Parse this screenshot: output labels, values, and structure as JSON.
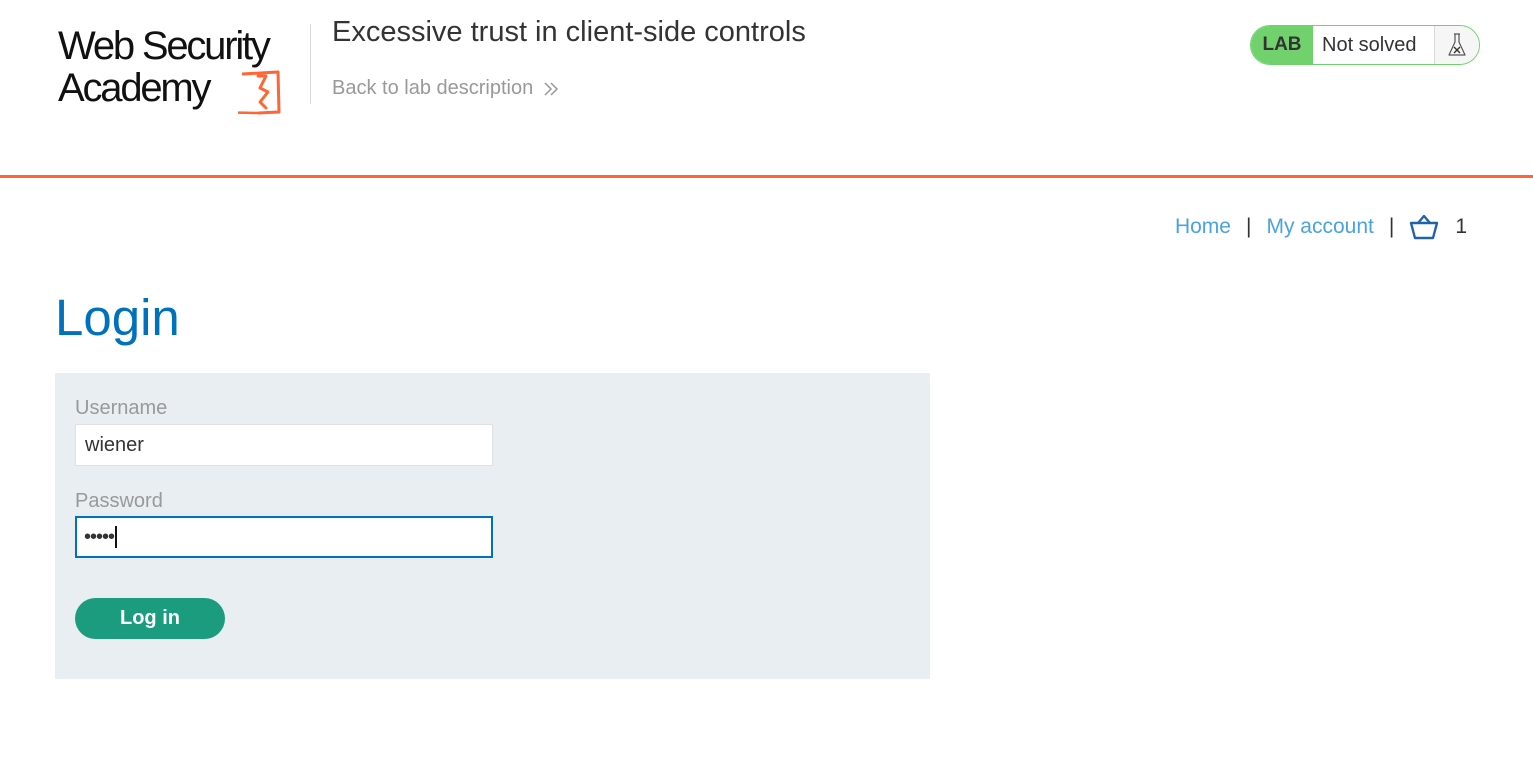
{
  "header": {
    "logo": {
      "line1": "Web Security",
      "line2": "Academy"
    },
    "lab_title": "Excessive trust in client-side controls",
    "back_link": "Back to lab description",
    "lab_status": {
      "badge": "LAB",
      "state": "Not solved"
    }
  },
  "nav": {
    "home": "Home",
    "separator": "|",
    "my_account": "My account",
    "cart_count": "1"
  },
  "main": {
    "title": "Login",
    "form": {
      "username_label": "Username",
      "username_value": "wiener",
      "password_label": "Password",
      "password_masked": "•••••",
      "submit_label": "Log in"
    }
  },
  "colors": {
    "accent_orange": "#ff6633",
    "title_blue": "#0071bc",
    "link_blue": "#4aa3df",
    "lab_green": "#70d16d",
    "button_green": "#1b9c7f",
    "panel_bg": "#e9eef2"
  },
  "icons": {
    "back": "double-chevron-right-icon",
    "lab": "flask-icon",
    "cart": "basket-icon",
    "logo_mark": "academy-logo-mark"
  }
}
